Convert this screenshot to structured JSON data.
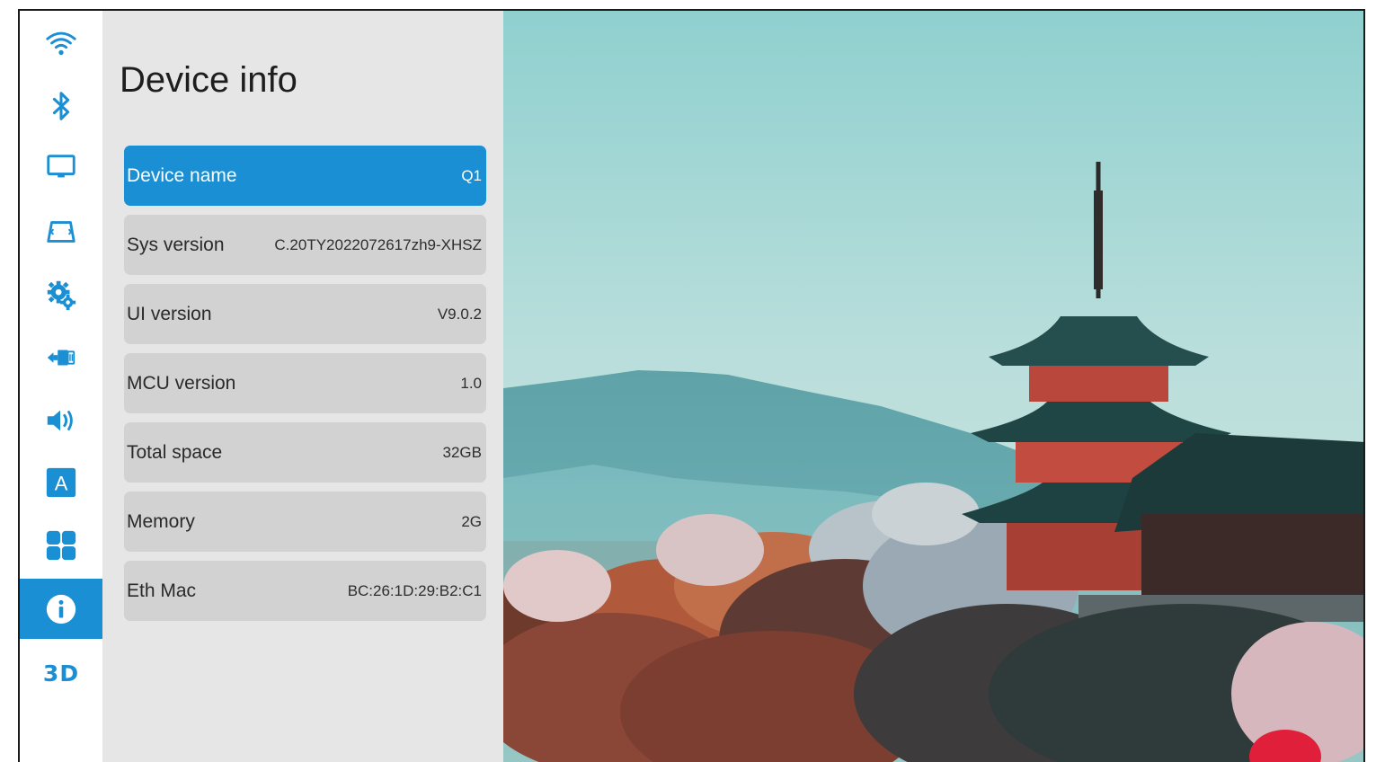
{
  "sidebar": {
    "items": [
      {
        "icon": "wifi-icon"
      },
      {
        "icon": "bluetooth-icon"
      },
      {
        "icon": "display-icon"
      },
      {
        "icon": "keystone-icon"
      },
      {
        "icon": "settings-gear-icon"
      },
      {
        "icon": "input-source-icon"
      },
      {
        "icon": "volume-icon"
      },
      {
        "icon": "language-icon",
        "label": "A"
      },
      {
        "icon": "apps-grid-icon"
      },
      {
        "icon": "info-icon",
        "active": true
      },
      {
        "icon": "3d-icon",
        "label": "3D"
      }
    ]
  },
  "panel": {
    "title": "Device info",
    "rows": [
      {
        "label": "Device name",
        "value": "Q1",
        "selected": true
      },
      {
        "label": "Sys version",
        "value": "C.20TY2022072617zh9-XHSZ"
      },
      {
        "label": "UI version",
        "value": "V9.0.2"
      },
      {
        "label": "MCU version",
        "value": "1.0"
      },
      {
        "label": "Total space",
        "value": "32GB"
      },
      {
        "label": "Memory",
        "value": "2G"
      },
      {
        "label": "Eth Mac",
        "value": "BC:26:1D:29:B2:C1"
      }
    ]
  },
  "colors": {
    "accent": "#1b8fd3",
    "panel_bg": "#e6e6e6",
    "row_bg": "#d2d2d2",
    "rail_bg": "#ffffff"
  }
}
